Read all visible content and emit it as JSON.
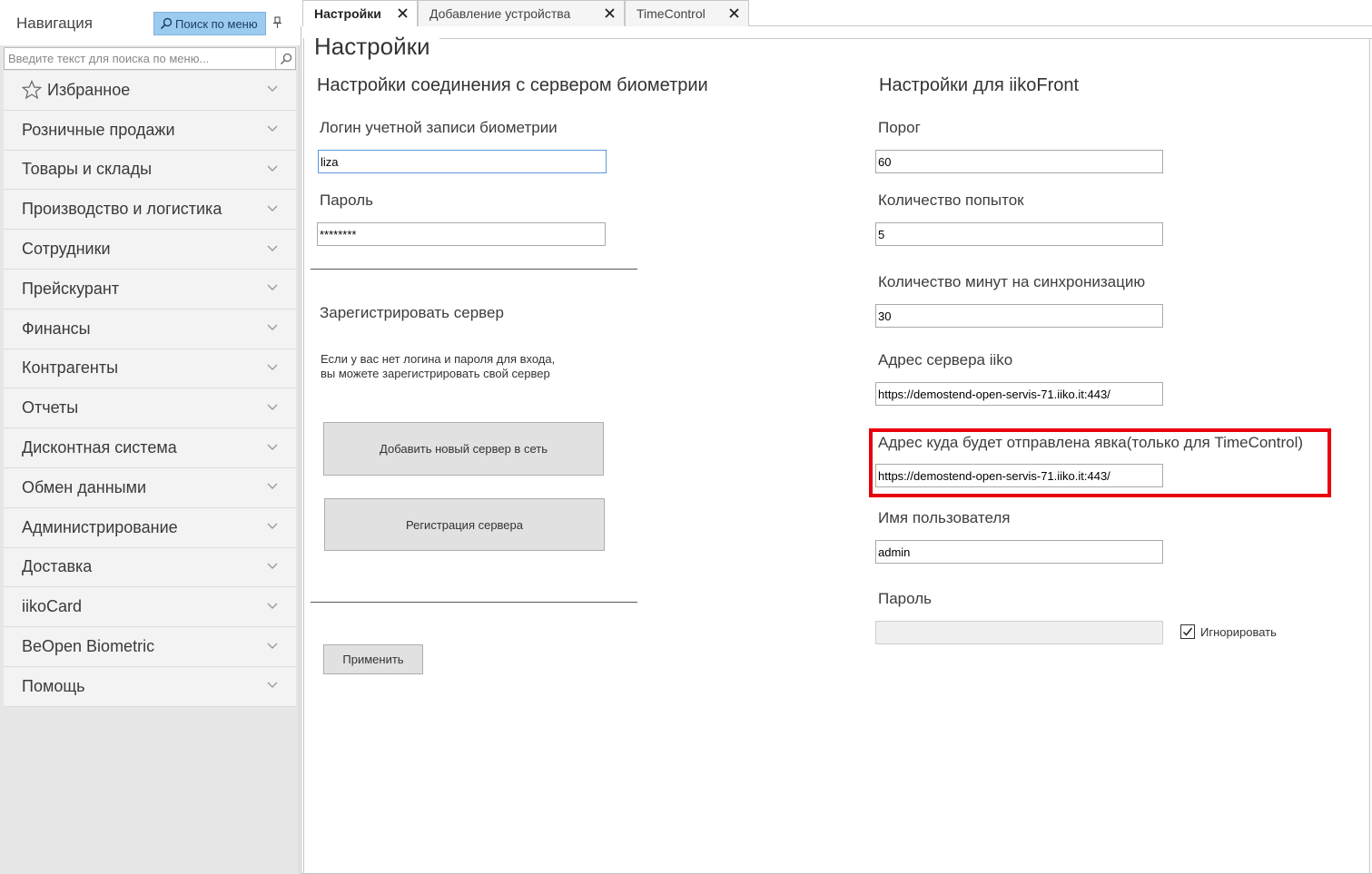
{
  "sidebar": {
    "title": "Навигация",
    "search_button": "Поиск по меню",
    "search_placeholder": "Введите текст для поиска по меню...",
    "items": [
      {
        "label": "Избранное"
      },
      {
        "label": "Розничные продажи"
      },
      {
        "label": "Товары и склады"
      },
      {
        "label": "Производство и логистика"
      },
      {
        "label": "Сотрудники"
      },
      {
        "label": "Прейскурант"
      },
      {
        "label": "Финансы"
      },
      {
        "label": "Контрагенты"
      },
      {
        "label": "Отчеты"
      },
      {
        "label": "Дисконтная система"
      },
      {
        "label": "Обмен данными"
      },
      {
        "label": "Администрирование"
      },
      {
        "label": "Доставка"
      },
      {
        "label": "iikoCard"
      },
      {
        "label": "BeOpen Biometric"
      },
      {
        "label": "Помощь"
      }
    ]
  },
  "tabs": [
    {
      "label": "Настройки",
      "active": true
    },
    {
      "label": "Добавление устройства",
      "active": false
    },
    {
      "label": "TimeControl",
      "active": false
    }
  ],
  "page": {
    "title": "Настройки",
    "left": {
      "section_title": "Настройки соединения с сервером биометрии",
      "login_label": "Логин учетной записи биометрии",
      "login_value": "liza",
      "password_label": "Пароль",
      "password_value": "********",
      "register_title": "Зарегистрировать сервер",
      "register_hint_1": "Если у вас нет логина и пароля для входа,",
      "register_hint_2": "вы можете зарегистрировать свой сервер",
      "add_server_button": "Добавить новый сервер в сеть",
      "register_button": "Регистрация сервера",
      "apply_button": "Применить"
    },
    "right": {
      "section_title": "Настройки для iikoFront",
      "threshold_label": "Порог",
      "threshold_value": "60",
      "attempts_label": "Количество попыток",
      "attempts_value": "5",
      "sync_label": "Количество минут на синхронизацию",
      "sync_value": "30",
      "server_label": "Адрес сервера iiko",
      "server_value": "https://demostend-open-servis-71.iiko.it:443/",
      "attendance_label": "Адрес куда будет отправлена явка(только для TimeControl)",
      "attendance_value": "https://demostend-open-servis-71.iiko.it:443/",
      "username_label": "Имя пользователя",
      "username_value": "admin",
      "password_label": "Пароль",
      "password_value": "",
      "ignore_label": "Игнорировать",
      "ignore_checked": true
    }
  },
  "colors": {
    "highlight": "#e8000f",
    "search_button": "#9ccbf0"
  }
}
